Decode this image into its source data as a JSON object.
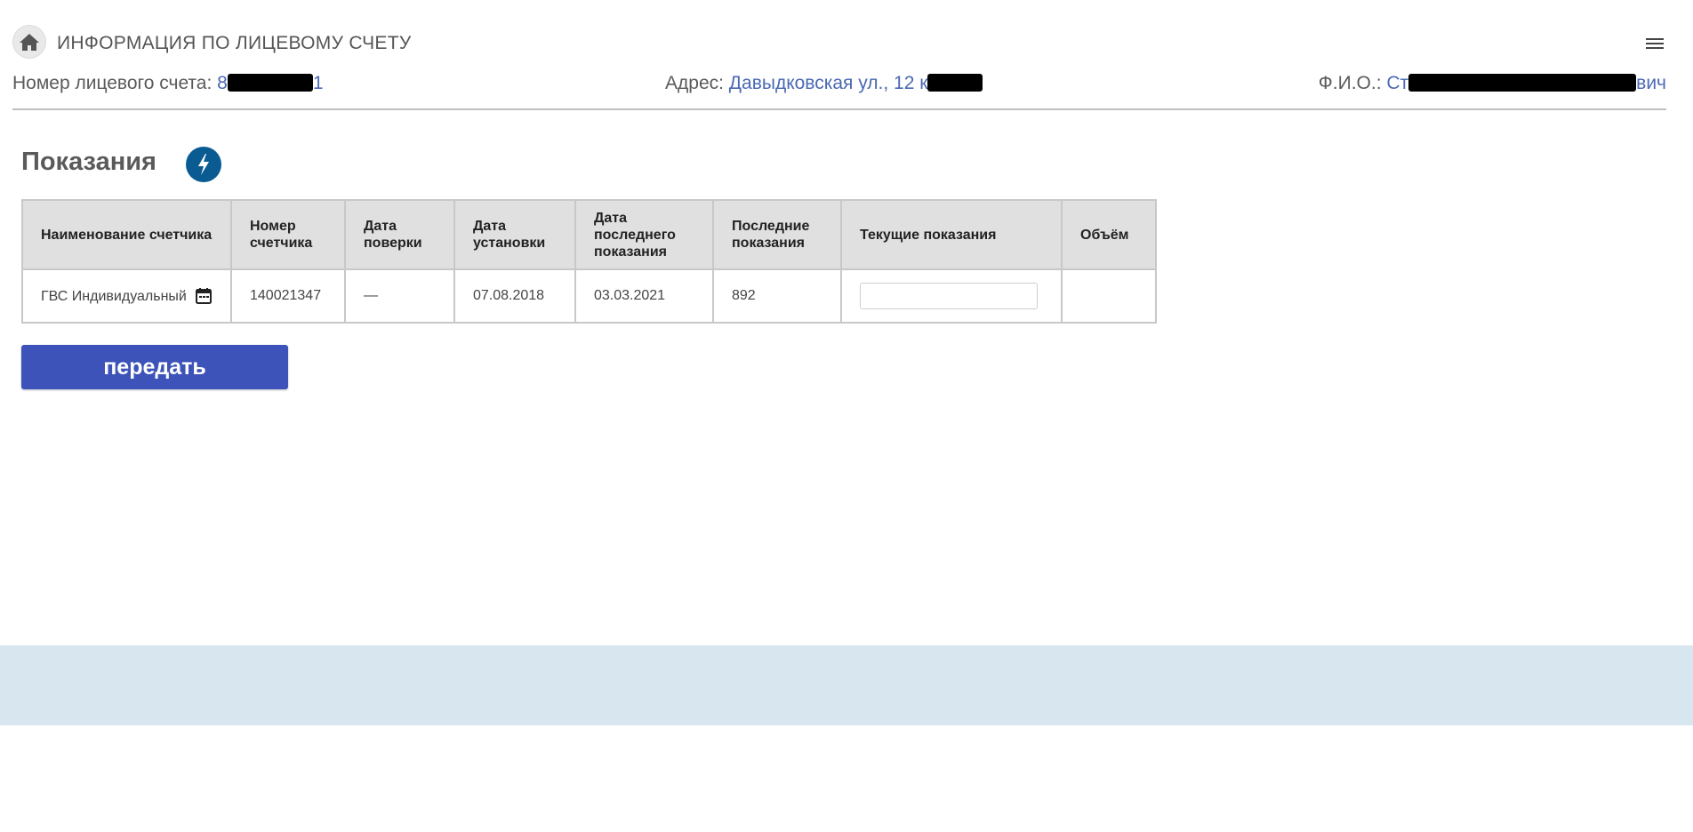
{
  "header": {
    "title": "ИНФОРМАЦИЯ ПО ЛИЦЕВОМУ СЧЕТУ",
    "home_icon": "home-icon",
    "menu_icon": "hamburger-menu-icon"
  },
  "info": {
    "account_label": "Номер лицевого счета:",
    "account_value_start": "8",
    "account_value_end": "1",
    "address_label": "Адрес:",
    "address_value": "Давыдковская ул., 12 к",
    "fio_label": "Ф.И.О.:",
    "fio_value_start": "Ст",
    "fio_value_end": "вич"
  },
  "section": {
    "title": "Показания",
    "badge_icon": "lightning-bolt-icon"
  },
  "table": {
    "headers": [
      "Наименование счетчика",
      "Номер счетчика",
      "Дата поверки",
      "Дата установки",
      "Дата последнего показания",
      "Последние показания",
      "Текущие показания",
      "Объём"
    ],
    "rows": [
      {
        "name": "ГВС Индивидуальный",
        "number": "140021347",
        "check_date": "—",
        "install_date": "07.08.2018",
        "last_reading_date": "03.03.2021",
        "last_reading": "892",
        "current_reading": "",
        "volume": ""
      }
    ]
  },
  "submit_label": "передать",
  "colors": {
    "link": "#4a69b4",
    "button": "#3e53b9",
    "badge": "#0a5b92",
    "footer": "#d8e6ef",
    "table_header": "#e0e0e0"
  }
}
